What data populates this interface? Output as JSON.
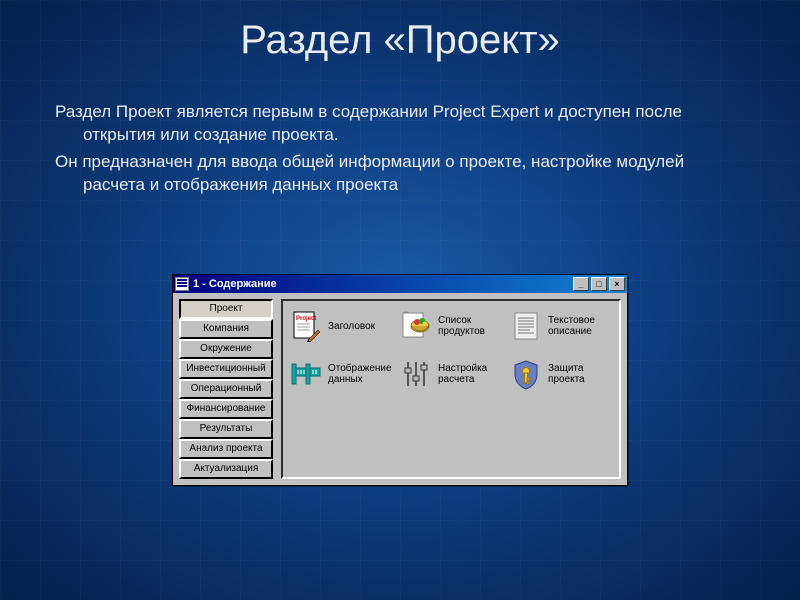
{
  "slide": {
    "title": "Раздел «Проект»",
    "para1": "Раздел Проект является первым в содержании Project Expert  и доступен после открытия или создание проекта.",
    "para2": "Он предназначен для ввода общей информации о проекте, настройке модулей расчета и отображения данных проекта"
  },
  "window": {
    "title": "1 - Содержание",
    "controls": {
      "min": "_",
      "max": "□",
      "close": "×"
    },
    "nav": [
      "Проект",
      "Компания",
      "Окружение",
      "Инвестиционный план",
      "Операционный план",
      "Финансирование",
      "Результаты",
      "Анализ проекта",
      "Актуализация"
    ],
    "nav_active_index": 0,
    "icons_row1": [
      {
        "key": "header",
        "label": "Заголовок"
      },
      {
        "key": "products",
        "label": "Список продуктов"
      },
      {
        "key": "text",
        "label": "Текстовое описание"
      }
    ],
    "icons_row2": [
      {
        "key": "display",
        "label": "Отображение данных"
      },
      {
        "key": "calc",
        "label": "Настройка расчета"
      },
      {
        "key": "protect",
        "label": "Защита проекта"
      }
    ]
  }
}
